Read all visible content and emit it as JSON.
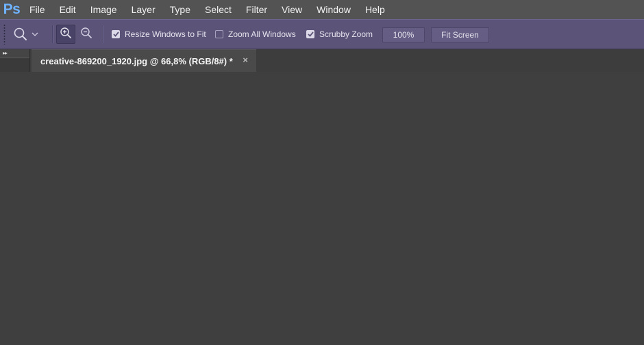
{
  "app": {
    "logo_text": "Ps",
    "accent_color": "#6fb3ff"
  },
  "menu": {
    "items": [
      {
        "label": "File"
      },
      {
        "label": "Edit"
      },
      {
        "label": "Image"
      },
      {
        "label": "Layer"
      },
      {
        "label": "Type"
      },
      {
        "label": "Select"
      },
      {
        "label": "Filter"
      },
      {
        "label": "View"
      },
      {
        "label": "Window"
      },
      {
        "label": "Help"
      }
    ]
  },
  "options_bar": {
    "tool_icon": "zoom-tool-icon",
    "zoom_in_icon": "zoom-in-icon",
    "zoom_out_icon": "zoom-out-icon",
    "zoom_in_active": true,
    "resize_windows": {
      "label": "Resize Windows to Fit",
      "checked": true
    },
    "zoom_all_windows": {
      "label": "Zoom All Windows",
      "checked": false
    },
    "scrubby_zoom": {
      "label": "Scrubby Zoom",
      "checked": true
    },
    "zoom_level": "100%",
    "fit_screen_label": "Fit Screen",
    "bar_color": "#5c5478"
  },
  "document": {
    "tab_title": "creative-869200_1920.jpg @ 66,8% (RGB/8#) *",
    "close_glyph": "×"
  },
  "panel_toggle": {
    "glyph": "▸▸"
  }
}
